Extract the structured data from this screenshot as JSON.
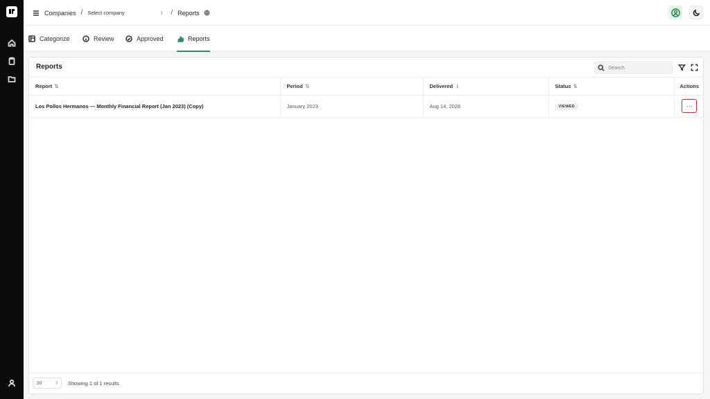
{
  "rail": {
    "items": [
      "home-icon",
      "clipboard-icon",
      "folder-icon"
    ],
    "bottom": "user-icon"
  },
  "header": {
    "companies_label": "Companies",
    "company_select_value": "Select company",
    "current_page": "Reports"
  },
  "tabs": [
    {
      "label": "Categorize",
      "icon": "categorize-icon"
    },
    {
      "label": "Review",
      "icon": "info-icon"
    },
    {
      "label": "Approved",
      "icon": "check-circle-icon"
    },
    {
      "label": "Reports",
      "icon": "bar-chart-icon",
      "active": true
    }
  ],
  "card": {
    "title": "Reports",
    "search_placeholder": "Search"
  },
  "table": {
    "columns": [
      "Report",
      "Period",
      "Delivered",
      "Status",
      "Actions"
    ],
    "sort_glyphs": [
      "⇅",
      "⇅",
      "⇂",
      "⇅"
    ],
    "rows": [
      {
        "report": "Los Pollos Hermanos — Monthly Financial Report (Jan 2023) (Copy)",
        "period": "January 2023",
        "delivered": "Aug 14, 2026",
        "status": "VIEWED",
        "actions": "···"
      }
    ]
  },
  "footer": {
    "page_size": "20",
    "showing": "Showing 1 of 1 results"
  },
  "colors": {
    "accent": "#2e8b6a",
    "rail": "#0b0b0b",
    "action_outline": "#d7262c"
  }
}
